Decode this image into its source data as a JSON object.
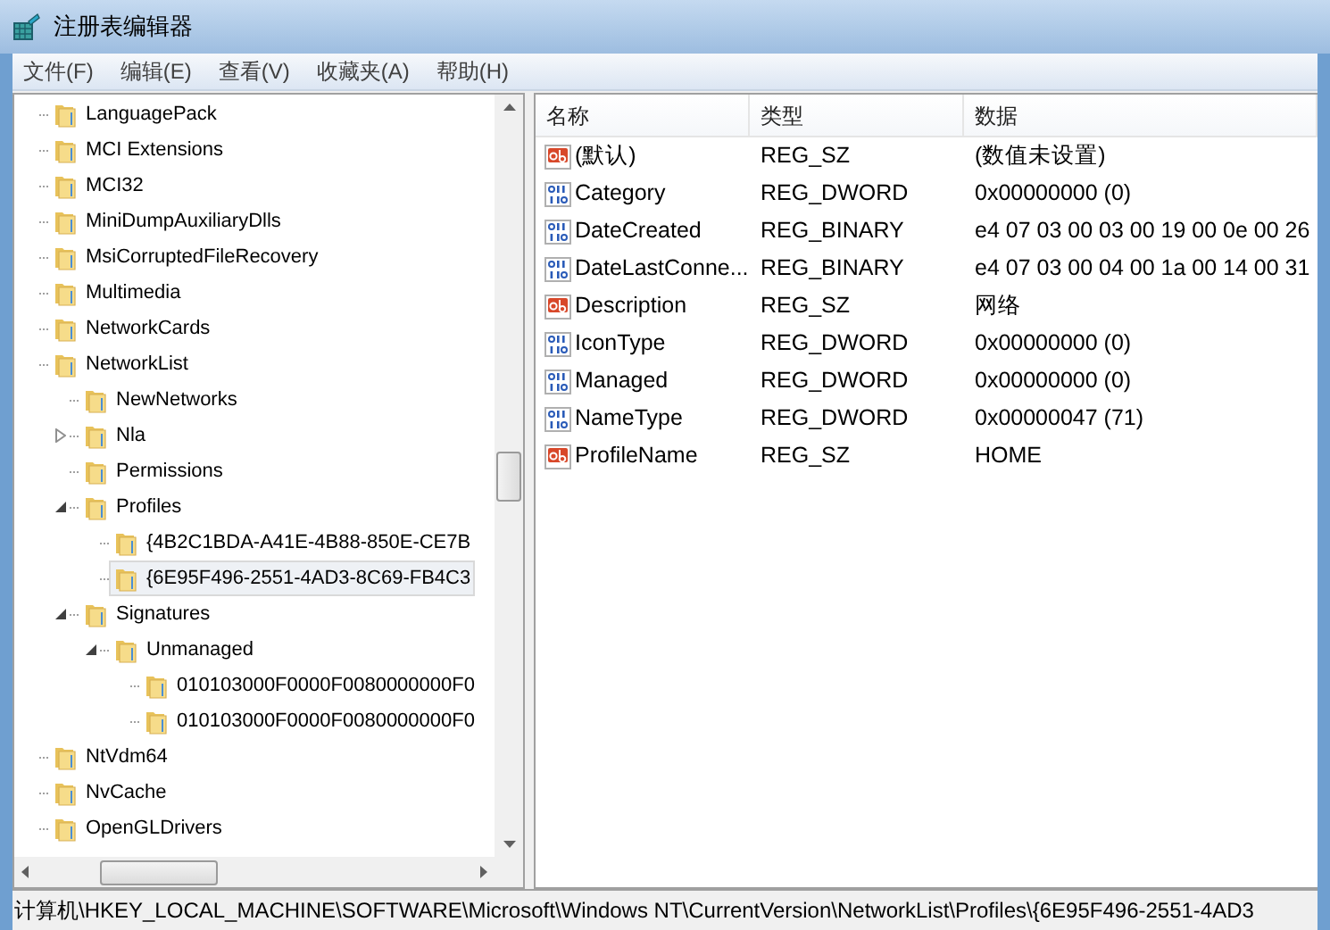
{
  "window": {
    "title": "注册表编辑器"
  },
  "menu": [
    "文件(F)",
    "编辑(E)",
    "查看(V)",
    "收藏夹(A)",
    "帮助(H)"
  ],
  "tree": [
    {
      "label": "LanguagePack",
      "selected": false
    },
    {
      "label": "MCI Extensions",
      "selected": false
    },
    {
      "label": "MCI32",
      "selected": false
    },
    {
      "label": "MiniDumpAuxiliaryDlls",
      "selected": false
    },
    {
      "label": "MsiCorruptedFileRecovery",
      "selected": false
    },
    {
      "label": "Multimedia",
      "selected": false
    },
    {
      "label": "NetworkCards",
      "selected": false
    },
    {
      "label": "NetworkList",
      "selected": false,
      "children": [
        {
          "label": "NewNetworks",
          "selected": false
        },
        {
          "label": "Nla",
          "selected": false,
          "expanded": false
        },
        {
          "label": "Permissions",
          "selected": false
        },
        {
          "label": "Profiles",
          "selected": false,
          "expanded": true,
          "children": [
            {
              "label": "{4B2C1BDA-A41E-4B88-850E-CE7B",
              "selected": false
            },
            {
              "label": "{6E95F496-2551-4AD3-8C69-FB4C3",
              "selected": true
            }
          ]
        },
        {
          "label": "Signatures",
          "selected": false,
          "expanded": true,
          "children": [
            {
              "label": "Unmanaged",
              "selected": false,
              "expanded": true,
              "children": [
                {
                  "label": "010103000F0000F0080000000F0",
                  "selected": false
                },
                {
                  "label": "010103000F0000F0080000000F0",
                  "selected": false
                }
              ]
            }
          ]
        }
      ]
    },
    {
      "label": "NtVdm64",
      "selected": false
    },
    {
      "label": "NvCache",
      "selected": false
    },
    {
      "label": "OpenGLDrivers",
      "selected": false
    }
  ],
  "table": {
    "columns": [
      "名称",
      "类型",
      "数据"
    ],
    "rows": [
      {
        "kind": "string",
        "name": "(默认)",
        "type": "REG_SZ",
        "data": "(数值未设置)"
      },
      {
        "kind": "number",
        "name": "Category",
        "type": "REG_DWORD",
        "data": "0x00000000 (0)"
      },
      {
        "kind": "number",
        "name": "DateCreated",
        "type": "REG_BINARY",
        "data": "e4 07 03 00 03 00 19 00 0e 00 26"
      },
      {
        "kind": "number",
        "name": "DateLastConne...",
        "type": "REG_BINARY",
        "data": "e4 07 03 00 04 00 1a 00 14 00 31"
      },
      {
        "kind": "string",
        "name": "Description",
        "type": "REG_SZ",
        "data": "网络"
      },
      {
        "kind": "number",
        "name": "IconType",
        "type": "REG_DWORD",
        "data": "0x00000000 (0)"
      },
      {
        "kind": "number",
        "name": "Managed",
        "type": "REG_DWORD",
        "data": "0x00000000 (0)"
      },
      {
        "kind": "number",
        "name": "NameType",
        "type": "REG_DWORD",
        "data": "0x00000047 (71)"
      },
      {
        "kind": "string",
        "name": "ProfileName",
        "type": "REG_SZ",
        "data": "HOME"
      }
    ]
  },
  "status_bar": "计算机\\HKEY_LOCAL_MACHINE\\SOFTWARE\\Microsoft\\Windows NT\\CurrentVersion\\NetworkList\\Profiles\\{6E95F496-2551-4AD3"
}
